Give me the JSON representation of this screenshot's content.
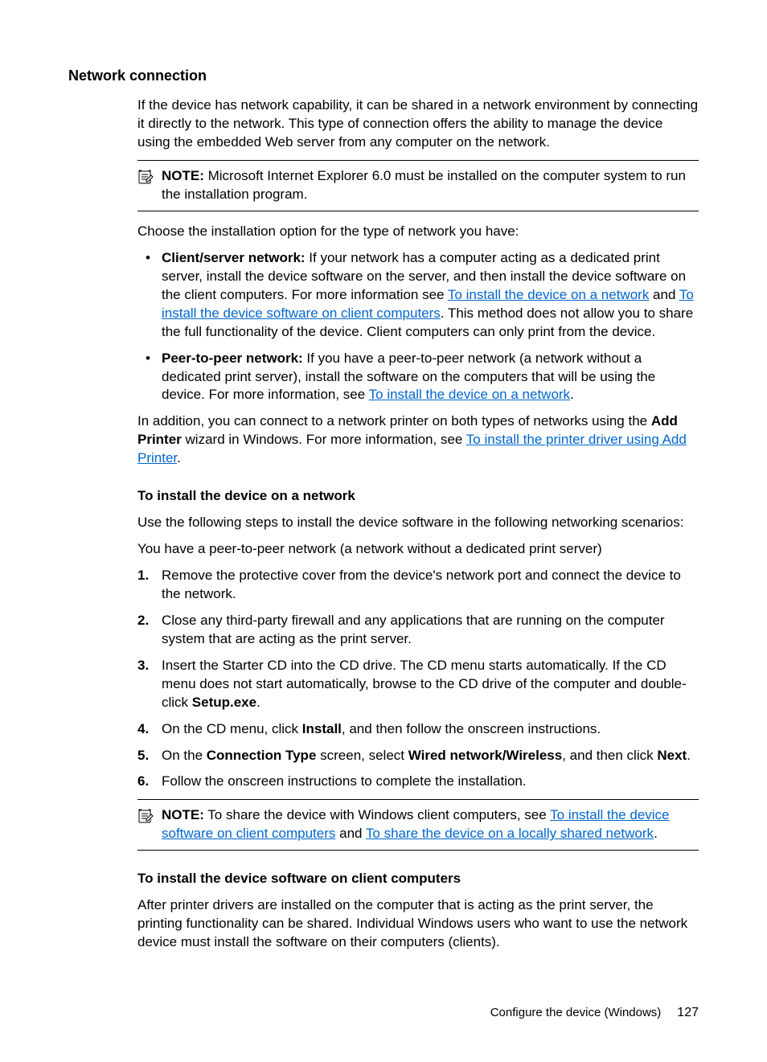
{
  "heading": "Network connection",
  "intro": "If the device has network capability, it can be shared in a network environment by connecting it directly to the network. This type of connection offers the ability to manage the device using the embedded Web server from any computer on the network.",
  "note1": {
    "label": "NOTE:",
    "text": " Microsoft Internet Explorer 6.0 must be installed on the computer system to run the installation program."
  },
  "choose": "Choose the installation option for the type of network you have:",
  "bullets": {
    "b1": {
      "label": "Client/server network:",
      "t1": " If your network has a computer acting as a dedicated print server, install the device software on the server, and then install the device software on the client computers. For more information see ",
      "link1": "To install the device on a network",
      "t2": " and ",
      "link2": "To install the device software on client computers",
      "t3": ". This method does not allow you to share the full functionality of the device. Client computers can only print from the device."
    },
    "b2": {
      "label": "Peer-to-peer network:",
      "t1": " If you have a peer-to-peer network (a network without a dedicated print server), install the software on the computers that will be using the device. For more information, see ",
      "link1": "To install the device on a network",
      "t2": "."
    }
  },
  "addition": {
    "t1": "In addition, you can connect to a network printer on both types of networks using the ",
    "bold1": "Add Printer",
    "t2": " wizard in Windows. For more information, see ",
    "link1": "To install the printer driver using Add Printer",
    "t3": "."
  },
  "section2": {
    "title": "To install the device on a network",
    "p1": "Use the following steps to install the device software in the following networking scenarios:",
    "p2": "You have a peer-to-peer network (a network without a dedicated print server)",
    "steps": {
      "s1": "Remove the protective cover from the device's network port and connect the device to the network.",
      "s2": "Close any third-party firewall and any applications that are running on the computer system that are acting as the print server.",
      "s3": {
        "t1": "Insert the Starter CD into the CD drive. The CD menu starts automatically. If the CD menu does not start automatically, browse to the CD drive of the computer and double-click ",
        "b1": "Setup.exe",
        "t2": "."
      },
      "s4": {
        "t1": "On the CD menu, click ",
        "b1": "Install",
        "t2": ", and then follow the onscreen instructions."
      },
      "s5": {
        "t1": "On the ",
        "b1": "Connection Type",
        "t2": " screen, select ",
        "b2": "Wired network/Wireless",
        "t3": ", and then click ",
        "b3": "Next",
        "t4": "."
      },
      "s6": "Follow the onscreen instructions to complete the installation."
    }
  },
  "note2": {
    "label": "NOTE:",
    "t1": " To share the device with Windows client computers, see ",
    "link1": "To install the device software on client computers",
    "t2": " and ",
    "link2": "To share the device on a locally shared network",
    "t3": "."
  },
  "section3": {
    "title": "To install the device software on client computers",
    "p1": "After printer drivers are installed on the computer that is acting as the print server, the printing functionality can be shared. Individual Windows users who want to use the network device must install the software on their computers (clients)."
  },
  "footer": {
    "text": "Configure the device (Windows)",
    "page": "127"
  }
}
